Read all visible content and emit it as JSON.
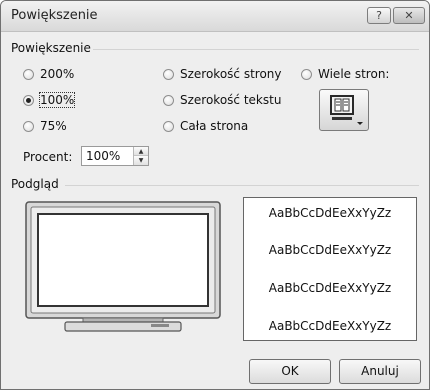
{
  "window": {
    "title": "Powiększenie",
    "help_label": "?",
    "close_label": "✕"
  },
  "zoom_group": {
    "label": "Powiększenie",
    "options": [
      {
        "label": "200%",
        "checked": false
      },
      {
        "label": "100%",
        "checked": true
      },
      {
        "label": "75%",
        "checked": false
      },
      {
        "label": "Szerokość strony",
        "checked": false
      },
      {
        "label": "Szerokość tekstu",
        "checked": false
      },
      {
        "label": "Cała strona",
        "checked": false
      },
      {
        "label": "Wiele stron:",
        "checked": false
      }
    ],
    "multi_page_icon": "monitor-pages-icon"
  },
  "percent": {
    "label": "Procent:",
    "value": "100%",
    "up_icon": "spin-up-arrow-icon",
    "down_icon": "spin-down-arrow-icon"
  },
  "preview": {
    "label": "Podgląd",
    "monitor_icon": "monitor-preview-icon",
    "sample_lines": [
      "AaBbCcDdEeXxYyZz",
      "AaBbCcDdEeXxYyZz",
      "AaBbCcDdEeXxYyZz",
      "AaBbCcDdEeXxYyZz"
    ]
  },
  "buttons": {
    "ok": "OK",
    "cancel": "Anuluj"
  }
}
